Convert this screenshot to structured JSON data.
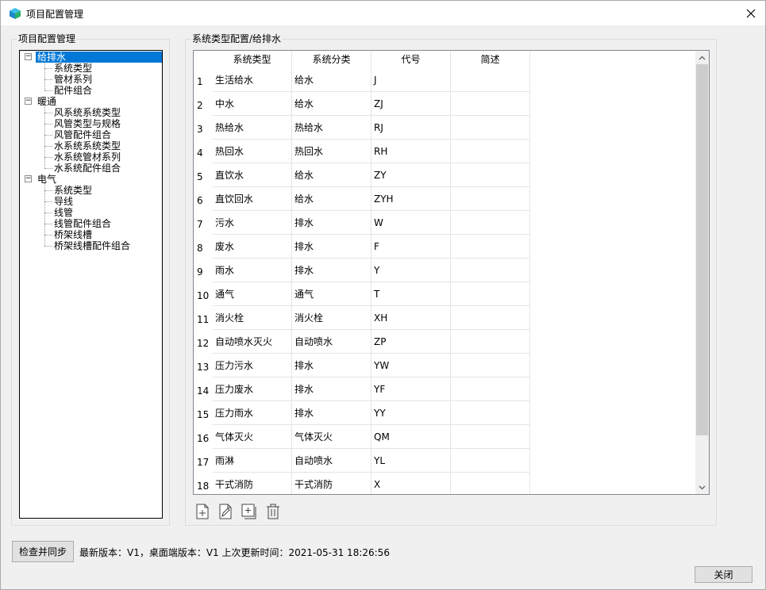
{
  "window": {
    "title": "项目配置管理"
  },
  "left_panel": {
    "group_title": "项目配置管理",
    "tree": [
      {
        "label": "给排水",
        "level": 0,
        "expanded": true,
        "selected": true
      },
      {
        "label": "系统类型",
        "level": 1
      },
      {
        "label": "管材系列",
        "level": 1
      },
      {
        "label": "配件组合",
        "level": 1
      },
      {
        "label": "暖通",
        "level": 0,
        "expanded": true
      },
      {
        "label": "风系统系统类型",
        "level": 1
      },
      {
        "label": "风管类型与规格",
        "level": 1
      },
      {
        "label": "风管配件组合",
        "level": 1
      },
      {
        "label": "水系统系统类型",
        "level": 1
      },
      {
        "label": "水系统管材系列",
        "level": 1
      },
      {
        "label": "水系统配件组合",
        "level": 1
      },
      {
        "label": "电气",
        "level": 0,
        "expanded": true
      },
      {
        "label": "系统类型",
        "level": 1
      },
      {
        "label": "导线",
        "level": 1
      },
      {
        "label": "线管",
        "level": 1
      },
      {
        "label": "线管配件组合",
        "level": 1
      },
      {
        "label": "桥架线槽",
        "level": 1
      },
      {
        "label": "桥架线槽配件组合",
        "level": 1
      }
    ],
    "expander_glyph": "−"
  },
  "right_panel": {
    "group_title": "系统类型配置/给排水",
    "columns": [
      "系统类型",
      "系统分类",
      "代号",
      "简述"
    ],
    "rows": [
      {
        "num": "1",
        "type": "生活给水",
        "category": "给水",
        "code": "J",
        "desc": ""
      },
      {
        "num": "2",
        "type": "中水",
        "category": "给水",
        "code": "ZJ",
        "desc": ""
      },
      {
        "num": "3",
        "type": "热给水",
        "category": "热给水",
        "code": "RJ",
        "desc": ""
      },
      {
        "num": "4",
        "type": "热回水",
        "category": "热回水",
        "code": "RH",
        "desc": ""
      },
      {
        "num": "5",
        "type": "直饮水",
        "category": "给水",
        "code": "ZY",
        "desc": ""
      },
      {
        "num": "6",
        "type": "直饮回水",
        "category": "给水",
        "code": "ZYH",
        "desc": ""
      },
      {
        "num": "7",
        "type": "污水",
        "category": "排水",
        "code": "W",
        "desc": ""
      },
      {
        "num": "8",
        "type": "废水",
        "category": "排水",
        "code": "F",
        "desc": ""
      },
      {
        "num": "9",
        "type": "雨水",
        "category": "排水",
        "code": "Y",
        "desc": ""
      },
      {
        "num": "10",
        "type": "通气",
        "category": "通气",
        "code": "T",
        "desc": ""
      },
      {
        "num": "11",
        "type": "消火栓",
        "category": "消火栓",
        "code": "XH",
        "desc": ""
      },
      {
        "num": "12",
        "type": "自动喷水灭火",
        "category": "自动喷水",
        "code": "ZP",
        "desc": ""
      },
      {
        "num": "13",
        "type": "压力污水",
        "category": "排水",
        "code": "YW",
        "desc": ""
      },
      {
        "num": "14",
        "type": "压力废水",
        "category": "排水",
        "code": "YF",
        "desc": ""
      },
      {
        "num": "15",
        "type": "压力雨水",
        "category": "排水",
        "code": "YY",
        "desc": ""
      },
      {
        "num": "16",
        "type": "气体灭火",
        "category": "气体灭火",
        "code": "QM",
        "desc": ""
      },
      {
        "num": "17",
        "type": "雨淋",
        "category": "自动喷水",
        "code": "YL",
        "desc": ""
      },
      {
        "num": "18",
        "type": "干式消防",
        "category": "干式消防",
        "code": "X",
        "desc": ""
      }
    ],
    "toolbar": [
      "add-icon",
      "edit-icon",
      "add-copy-icon",
      "delete-icon"
    ]
  },
  "footer": {
    "sync_button": "检查并同步",
    "status": "最新版本：V1，桌面端版本：V1 上次更新时间：2021-05-31 18:26:56",
    "close_button": "关闭"
  },
  "colors": {
    "selection": "#0078d7",
    "window_bg": "#f0f0f0",
    "grid_line": "#e5e5e5"
  }
}
